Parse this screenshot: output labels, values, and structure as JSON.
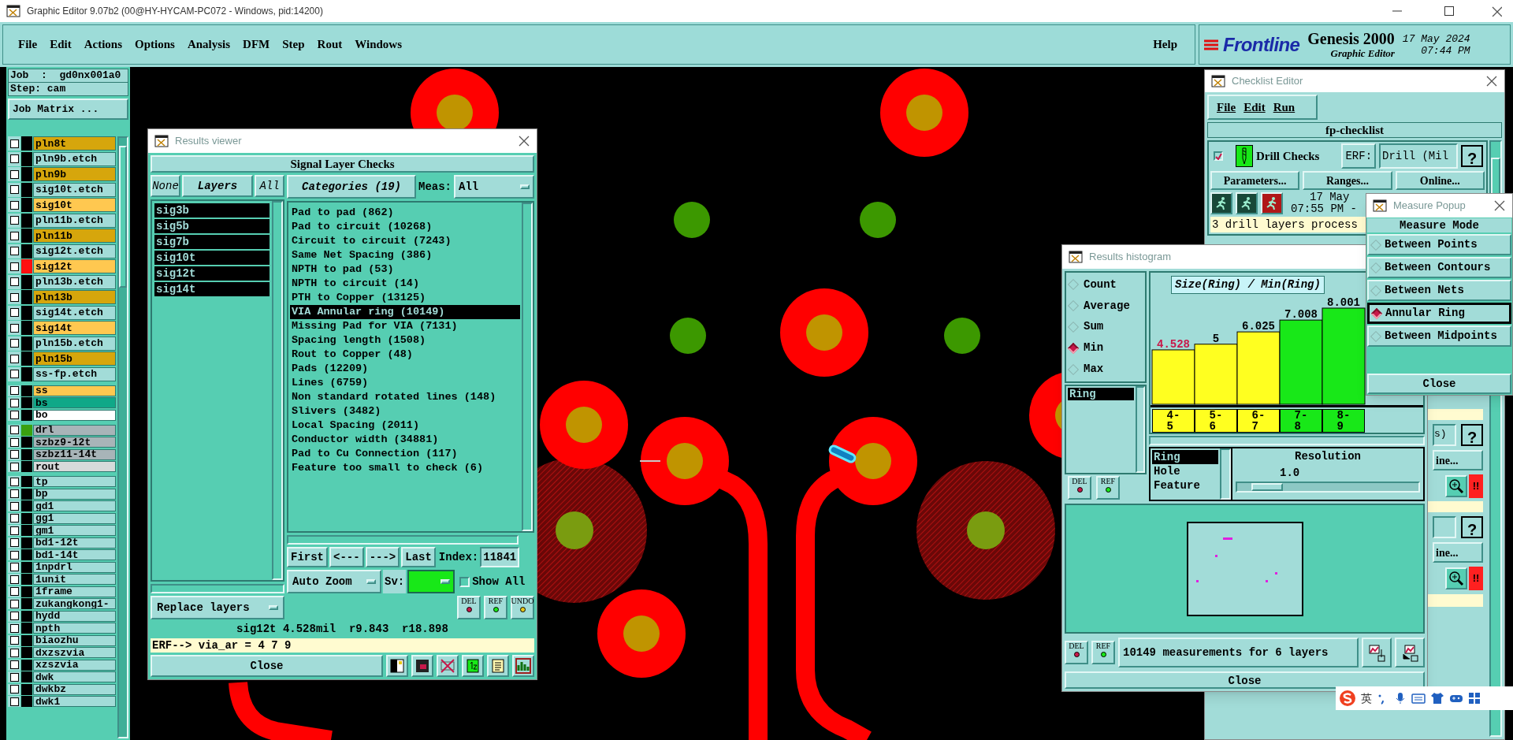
{
  "app_window": {
    "title": "Graphic Editor 9.07b2 (00@HY-HYCAM-PC072 - Windows, pid:14200)",
    "menu": [
      "File",
      "Edit",
      "Actions",
      "Options",
      "Analysis",
      "DFM",
      "Step",
      "Rout",
      "Windows"
    ],
    "help": "Help",
    "brand": {
      "logo": "Frontline",
      "product": "Genesis 2000",
      "subtitle": "Graphic Editor",
      "date": "17 May 2024",
      "time": "07:44 PM"
    }
  },
  "job_panel": {
    "job": "Job  :  gd0nx001a0",
    "step": "Step: cam",
    "matrix_button": "Job Matrix ...",
    "layer_groups": [
      {
        "layers": [
          {
            "name": "pln8t",
            "color": "#d6a60c",
            "checked": false
          },
          {
            "name": "pln9b.etch",
            "color": "#a2dcd8",
            "checked": false
          },
          {
            "name": "pln9b",
            "color": "#d6a60c",
            "checked": false
          },
          {
            "name": "sig10t.etch",
            "color": "#a2dcd8",
            "checked": false
          },
          {
            "name": "sig10t",
            "color": "#ffc850",
            "checked": false
          },
          {
            "name": "pln11b.etch",
            "color": "#a2dcd8",
            "checked": false
          },
          {
            "name": "pln11b",
            "color": "#d6a60c",
            "checked": false
          },
          {
            "name": "sig12t.etch",
            "color": "#a2dcd8",
            "checked": false
          },
          {
            "name": "sig12t",
            "color": "#ffc850",
            "checked": false,
            "marker": {
              "color": "#ff1010"
            }
          },
          {
            "name": "pln13b.etch",
            "color": "#a2dcd8",
            "checked": false
          },
          {
            "name": "pln13b",
            "color": "#d6a60c",
            "checked": false
          },
          {
            "name": "sig14t.etch",
            "color": "#a2dcd8",
            "checked": false
          },
          {
            "name": "sig14t",
            "color": "#ffc850",
            "checked": false
          },
          {
            "name": "pln15b.etch",
            "color": "#a2dcd8",
            "checked": false
          },
          {
            "name": "pln15b",
            "color": "#d6a60c",
            "checked": false
          },
          {
            "name": "ss-fp.etch",
            "color": "#a2dcd8",
            "checked": false
          }
        ]
      },
      {
        "layers": [
          {
            "name": "ss",
            "color": "#ffc850",
            "checked": false
          },
          {
            "name": "bs",
            "color": "#10a888",
            "checked": false
          },
          {
            "name": "bo",
            "color": "#ffffff",
            "checked": false
          }
        ]
      },
      {
        "layers": [
          {
            "name": "drl",
            "color": "#a8b4b8",
            "checked": false,
            "marker": {
              "color": "#3aa010"
            }
          },
          {
            "name": "szbz9-12t",
            "color": "#a8b4b8",
            "checked": false
          },
          {
            "name": "szbz11-14t",
            "color": "#a8b4b8",
            "checked": false
          },
          {
            "name": "rout",
            "color": "#d6dada",
            "checked": false
          }
        ]
      },
      {
        "layers": [
          {
            "name": "tp",
            "color": "#a2dcd8",
            "checked": false
          },
          {
            "name": "bp",
            "color": "#a2dcd8",
            "checked": false
          },
          {
            "name": "gd1",
            "color": "#a2dcd8",
            "checked": false
          },
          {
            "name": "gg1",
            "color": "#a2dcd8",
            "checked": false
          },
          {
            "name": "gm1",
            "color": "#a2dcd8",
            "checked": false
          },
          {
            "name": "bd1-12t",
            "color": "#a2dcd8",
            "checked": false
          },
          {
            "name": "bd1-14t",
            "color": "#a2dcd8",
            "checked": false
          },
          {
            "name": "1npdrl",
            "color": "#a2dcd8",
            "checked": false
          },
          {
            "name": "1unit",
            "color": "#a2dcd8",
            "checked": false
          },
          {
            "name": "1frame",
            "color": "#a2dcd8",
            "checked": false
          },
          {
            "name": "zukangkong1-",
            "color": "#a2dcd8",
            "checked": false
          },
          {
            "name": "hydd",
            "color": "#a2dcd8",
            "checked": false
          },
          {
            "name": "npth",
            "color": "#a2dcd8",
            "checked": false
          },
          {
            "name": "biaozhu",
            "color": "#a2dcd8",
            "checked": false
          },
          {
            "name": "dxzszvia",
            "color": "#a2dcd8",
            "checked": false
          },
          {
            "name": "xzszvia",
            "color": "#a2dcd8",
            "checked": false
          },
          {
            "name": "dwk",
            "color": "#a2dcd8",
            "checked": false
          },
          {
            "name": "dwkbz",
            "color": "#a2dcd8",
            "checked": false
          },
          {
            "name": "dwk1",
            "color": "#a2dcd8",
            "checked": false
          }
        ]
      }
    ]
  },
  "results_viewer": {
    "title": "Results viewer",
    "heading": "Signal Layer Checks",
    "layer_buttons": [
      "None",
      "Layers",
      "All"
    ],
    "layers": [
      {
        "name": "sig3b",
        "selected": true
      },
      {
        "name": "sig5b",
        "selected": true
      },
      {
        "name": "sig7b",
        "selected": true
      },
      {
        "name": "sig10t",
        "selected": true
      },
      {
        "name": "sig12t",
        "selected": true
      },
      {
        "name": "sig14t",
        "selected": true
      }
    ],
    "layer_mode": "Replace layers",
    "categories_button": "Categories (19)",
    "meas_label": "Meas:",
    "meas_value": "All",
    "categories": [
      {
        "label": "Pad to pad (862)",
        "selected": false
      },
      {
        "label": "Pad to circuit (10268)",
        "selected": false
      },
      {
        "label": "Circuit to circuit (7243)",
        "selected": false
      },
      {
        "label": "Same Net Spacing (386)",
        "selected": false
      },
      {
        "label": "NPTH to pad (53)",
        "selected": false
      },
      {
        "label": "NPTH to circuit (14)",
        "selected": false
      },
      {
        "label": "PTH to Copper (13125)",
        "selected": false
      },
      {
        "label": "VIA Annular ring (10149)",
        "selected": true
      },
      {
        "label": "Missing Pad for VIA (7131)",
        "selected": false
      },
      {
        "label": "Spacing length (1508)",
        "selected": false
      },
      {
        "label": "Rout to Copper (48)",
        "selected": false
      },
      {
        "label": "Pads (12209)",
        "selected": false
      },
      {
        "label": "Lines (6759)",
        "selected": false
      },
      {
        "label": "Non standard rotated lines (148)",
        "selected": false
      },
      {
        "label": "Slivers (3482)",
        "selected": false
      },
      {
        "label": "Local Spacing (2011)",
        "selected": false
      },
      {
        "label": "Conductor width (34881)",
        "selected": false
      },
      {
        "label": "Pad to Cu Connection (117)",
        "selected": false
      },
      {
        "label": "Feature too small to check (6)",
        "selected": false
      }
    ],
    "nav_buttons": [
      "First",
      "<---",
      "--->",
      "Last"
    ],
    "index_label": "Index:",
    "index_value": "11841",
    "zoom_mode": "Auto Zoom",
    "sv_label": "Sv:",
    "show_all": {
      "label": "Show All",
      "checked": false
    },
    "action_buttons": [
      "DEL",
      "REF",
      "UNDO"
    ],
    "status": "sig12t 4.528mil  r9.843  r18.898",
    "erf": "ERF--> via_ar = 4 7 9",
    "close": "Close"
  },
  "checklist_editor": {
    "title": "Checklist Editor",
    "menu": [
      "File",
      "Edit",
      "Run"
    ],
    "checklist_name": "fp-checklist",
    "action": {
      "enabled": true,
      "name": "Drill Checks",
      "erf_label": "ERF:",
      "erf_value": "Drill (Mil",
      "help": "?",
      "buttons": [
        "Parameters...",
        "Ranges...",
        "Online..."
      ],
      "date": "17 May",
      "time": "07:55 PM -",
      "report": "3 drill layers process"
    },
    "partial_actions": [
      {
        "field": "s)",
        "help": "?",
        "button": "ine...",
        "alert": "!!"
      },
      {
        "help": "?",
        "button": "ine...",
        "alert": "!!"
      }
    ]
  },
  "measure_popup": {
    "title": "Measure Popup",
    "heading": "Measure Mode",
    "modes": [
      {
        "label": "Between Points",
        "selected": false
      },
      {
        "label": "Between Contours",
        "selected": false
      },
      {
        "label": "Between Nets",
        "selected": false
      },
      {
        "label": "Annular Ring",
        "selected": true
      },
      {
        "label": "Between Midpoints",
        "selected": false
      }
    ],
    "close": "Close"
  },
  "results_histogram": {
    "title": "Results histogram",
    "stats": [
      {
        "label": "Count",
        "selected": false
      },
      {
        "label": "Average",
        "selected": false
      },
      {
        "label": "Sum",
        "selected": false
      },
      {
        "label": "Min",
        "selected": true
      },
      {
        "label": "Max",
        "selected": false
      }
    ],
    "measure_list": [
      {
        "label": "Ring",
        "selected": true
      }
    ],
    "list_buttons": [
      "DEL",
      "REF"
    ],
    "chart_data": {
      "type": "bar",
      "title": "Size(Ring) / Min(Ring)",
      "categories": [
        "4-5",
        "5-6",
        "6-7",
        "7-8",
        "8-9"
      ],
      "series": [
        {
          "color": "#ffff20",
          "values": [
            4.528,
            5,
            6.025,
            null,
            null
          ]
        },
        {
          "color": "#18e818",
          "values": [
            null,
            null,
            null,
            7.008,
            8.001
          ]
        }
      ],
      "stacked": true,
      "data_labels": true
    },
    "value_types": [
      {
        "label": "Ring",
        "selected": true
      },
      {
        "label": "Hole",
        "selected": false
      },
      {
        "label": "Feature",
        "selected": false
      }
    ],
    "resolution": {
      "label": "Resolution",
      "value": "1.0",
      "level": 0.08
    },
    "footer_buttons": [
      "DEL",
      "REF"
    ],
    "summary": "10149 measurements for 6 layers",
    "close": "Close"
  },
  "ime_toolbar": {
    "mode": "英"
  }
}
